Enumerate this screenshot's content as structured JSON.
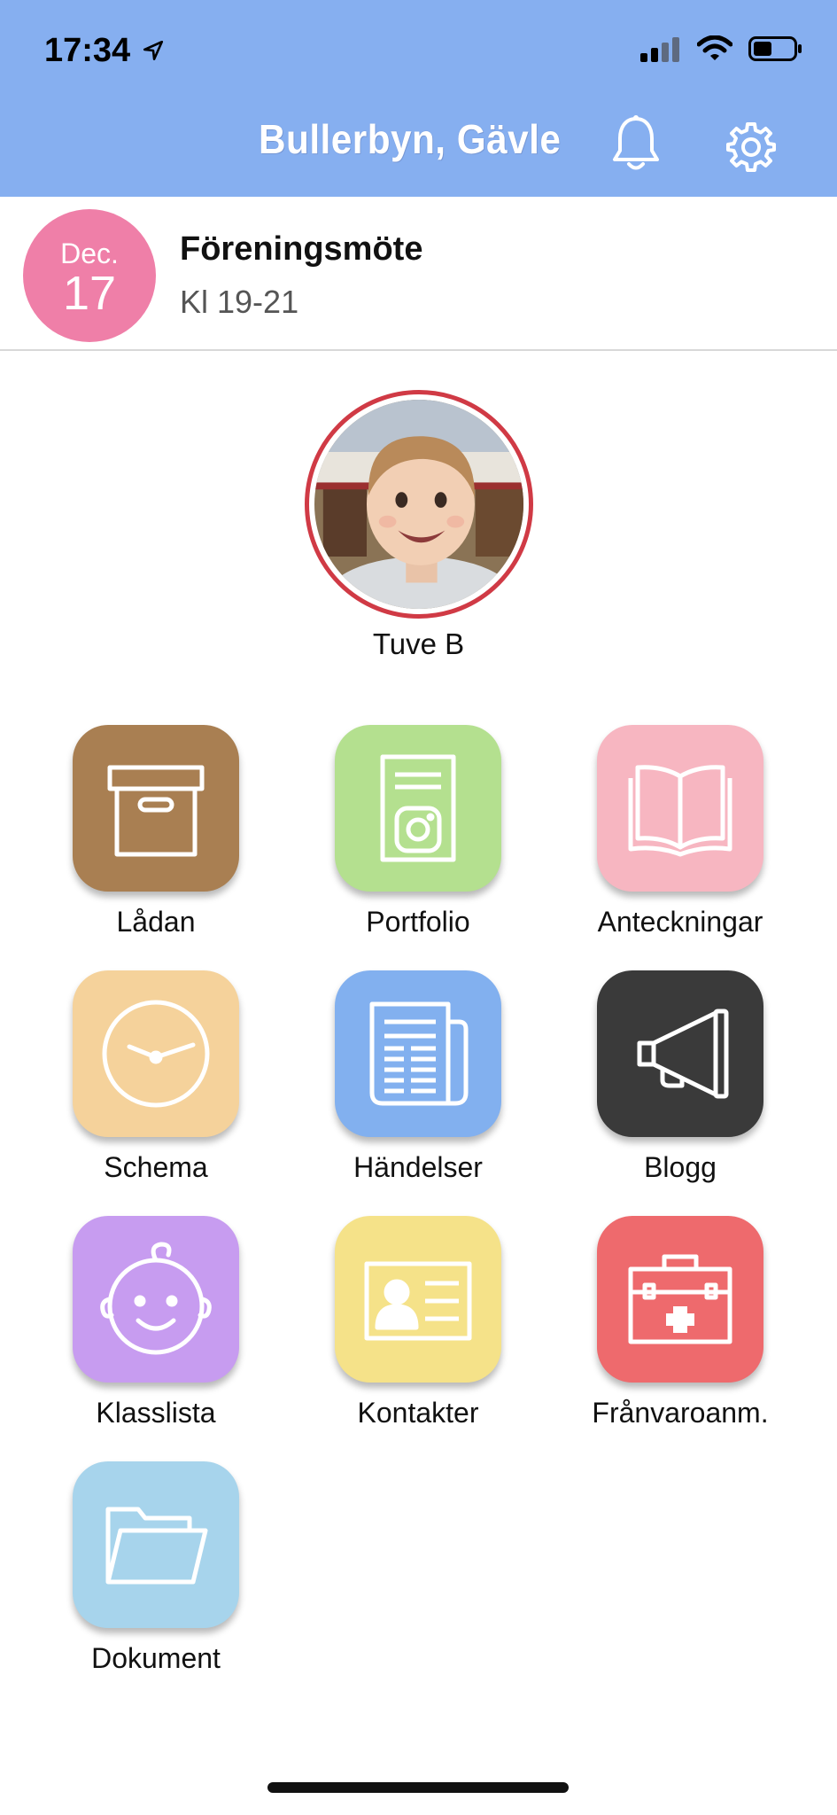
{
  "status_bar": {
    "time": "17:34"
  },
  "header": {
    "title": "Bullerbyn, Gävle"
  },
  "event": {
    "month": "Dec.",
    "day": "17",
    "title": "Föreningsmöte",
    "time": "Kl 19-21"
  },
  "profile": {
    "name": "Tuve B"
  },
  "tiles": [
    {
      "label": "Lådan",
      "color": "#a97f52",
      "icon": "box-icon"
    },
    {
      "label": "Portfolio",
      "color": "#b4e08f",
      "icon": "portfolio-icon"
    },
    {
      "label": "Anteckningar",
      "color": "#f7b6c1",
      "icon": "book-icon"
    },
    {
      "label": "Schema",
      "color": "#f5d29b",
      "icon": "clock-icon"
    },
    {
      "label": "Händelser",
      "color": "#82b0ef",
      "icon": "newspaper-icon"
    },
    {
      "label": "Blogg",
      "color": "#3a3a3a",
      "icon": "megaphone-icon"
    },
    {
      "label": "Klasslista",
      "color": "#c79cf0",
      "icon": "baby-face-icon"
    },
    {
      "label": "Kontakter",
      "color": "#f5e289",
      "icon": "contact-card-icon"
    },
    {
      "label": "Frånvaroanm.",
      "color": "#ee6a6d",
      "icon": "first-aid-icon"
    },
    {
      "label": "Dokument",
      "color": "#a7d4ec",
      "icon": "folder-icon"
    }
  ]
}
